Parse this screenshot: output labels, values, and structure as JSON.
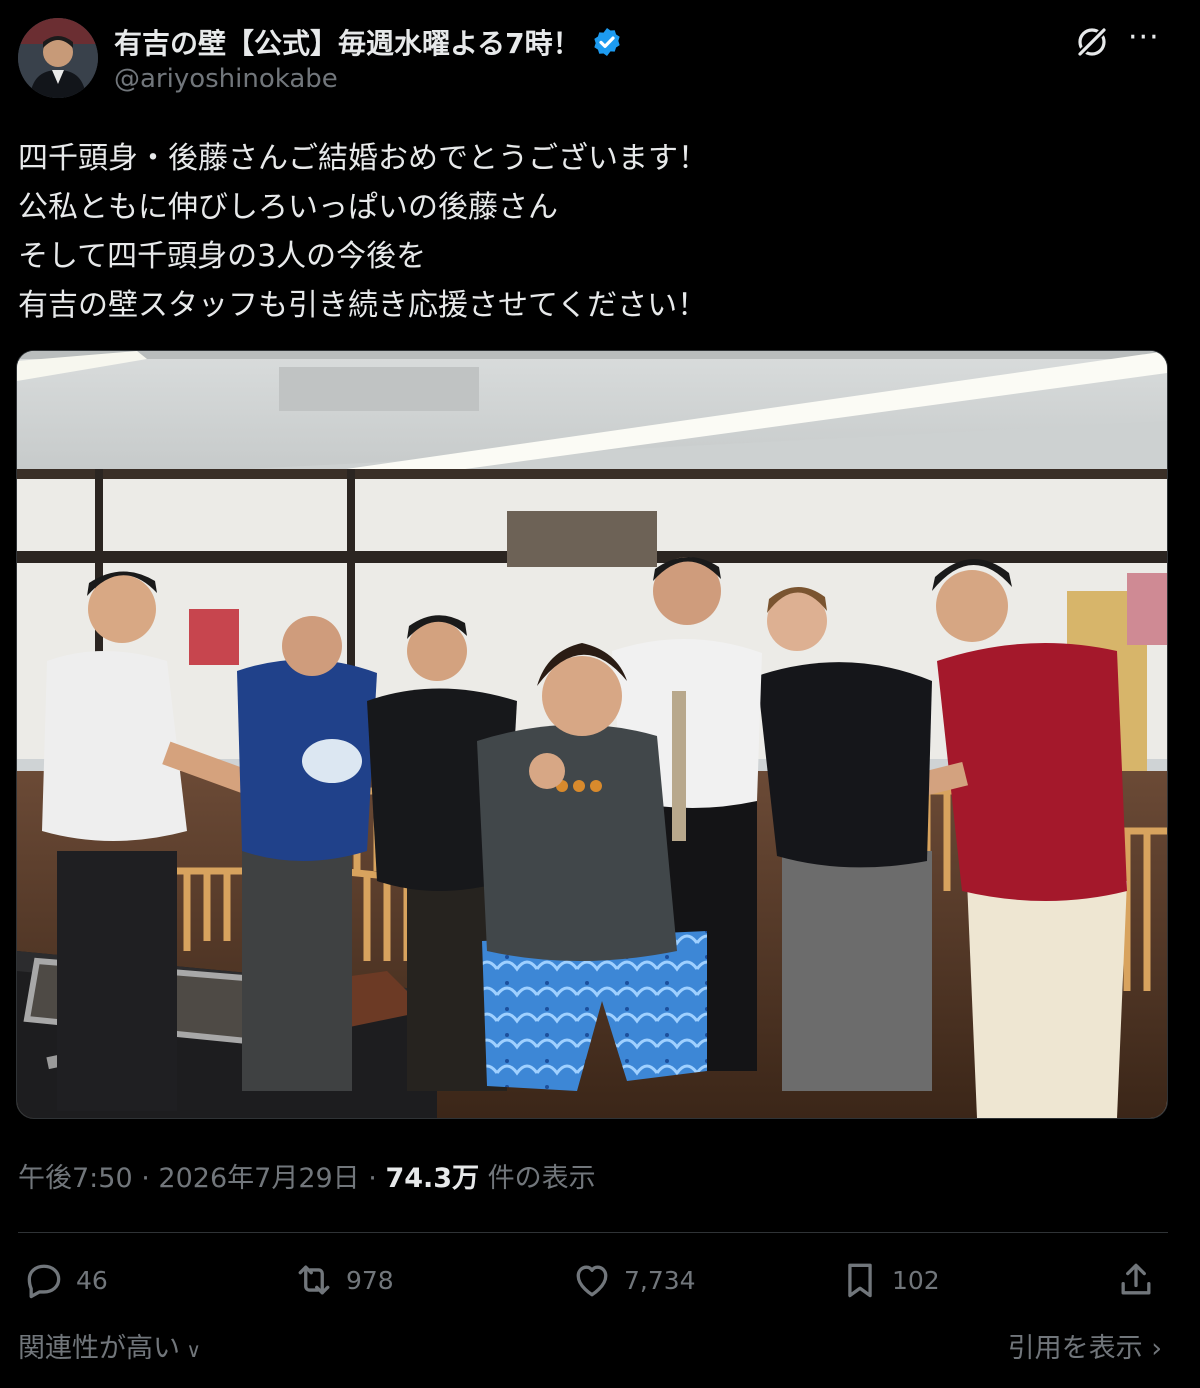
{
  "tweet": {
    "display_name": "有吉の壁【公式】毎週水曜よる7時！",
    "handle": "@ariyoshinokabe",
    "lines": [
      "四千頭身・後藤さんご結婚おめでとうございます！",
      "公私ともに伸びしろいっぱいの後藤さん",
      "そして四千頭身の3人の今後を",
      "有吉の壁スタッフも引き続き応援させてください！"
    ],
    "time": "午後7:50",
    "separator": "·",
    "date": "2026年7月29日",
    "views_count": "74.3万",
    "views_label": "件の表示"
  },
  "actions": {
    "replies": "46",
    "reposts": "978",
    "likes": "7,734",
    "bookmarks": "102"
  },
  "footer": {
    "sort_label": "関連性が高い",
    "quotes_label": "引用を表示"
  },
  "icons": {
    "verified": "verified-badge-icon",
    "grok": "grok-icon",
    "more": "more-icon",
    "reply": "reply-icon",
    "repost": "repost-icon",
    "like": "heart-icon",
    "bookmark": "bookmark-icon",
    "share": "share-icon"
  },
  "colors": {
    "background": "#000000",
    "text": "#e7e9ea",
    "secondary": "#71767b",
    "verified": "#1d9bf0"
  }
}
